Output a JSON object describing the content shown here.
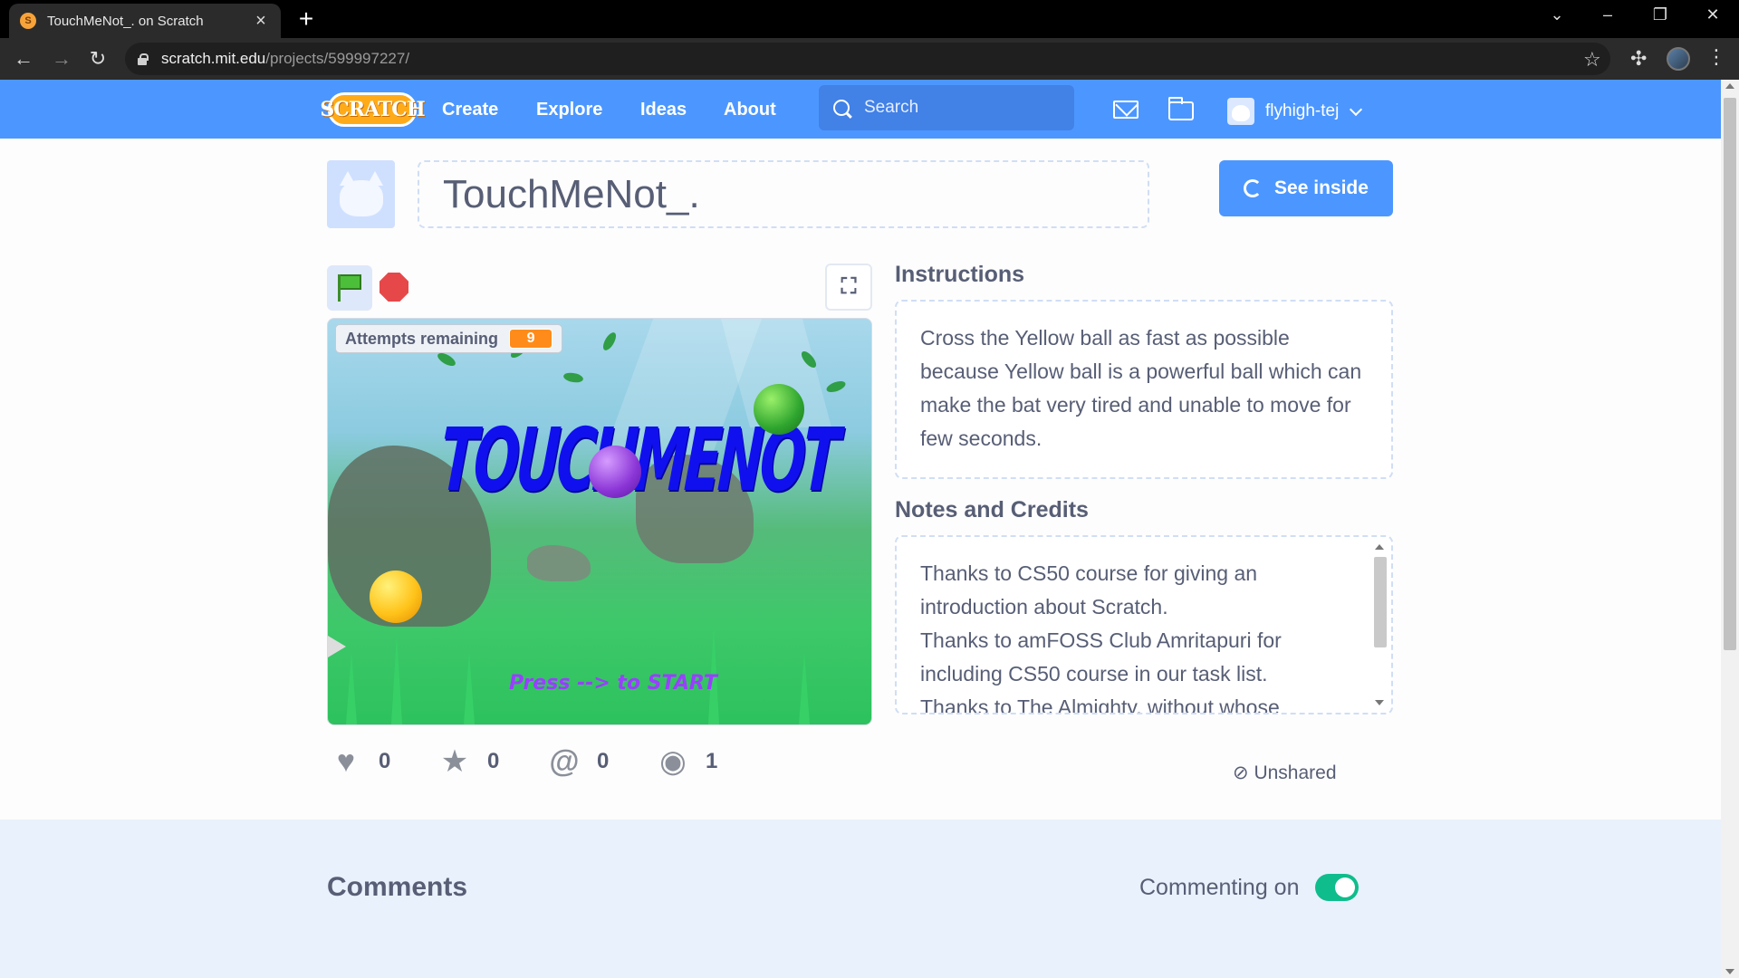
{
  "browser": {
    "tab_title": "TouchMeNot_. on Scratch",
    "url_host": "scratch.mit.edu",
    "url_path": "/projects/599997227/"
  },
  "nav": {
    "logo_text": "SCRATCH",
    "links": [
      "Create",
      "Explore",
      "Ideas",
      "About"
    ],
    "search_placeholder": "Search",
    "username": "flyhigh-tej"
  },
  "project": {
    "title": "TouchMeNot_.",
    "see_inside_label": "See inside",
    "stage": {
      "monitor_label": "Attempts remaining",
      "monitor_value": "9",
      "title_art": "TOUCHMENOT",
      "press_text": "Press --> to START"
    },
    "instructions_heading": "Instructions",
    "instructions_text": "Cross the Yellow ball as fast as possible because Yellow ball is a powerful ball which can make the bat very tired and unable to move for few seconds.",
    "notes_heading": "Notes and Credits",
    "notes_lines": [
      "Thanks to CS50 course for giving an introduction about Scratch.",
      "Thanks to amFOSS Club Amritapuri for including CS50 course in our task list.",
      "Thanks to The Almighty, without whose"
    ],
    "stats": {
      "loves": "0",
      "favorites": "0",
      "remixes": "0",
      "views": "1"
    },
    "share_status": "Unshared"
  },
  "comments": {
    "heading": "Comments",
    "commenting_label": "Commenting on",
    "commenting_enabled": true
  },
  "colors": {
    "scratch_blue": "#4c97ff",
    "text": "#575e75",
    "toggle_on": "#0fbd8c",
    "monitor_orange": "#ff8c1a"
  }
}
